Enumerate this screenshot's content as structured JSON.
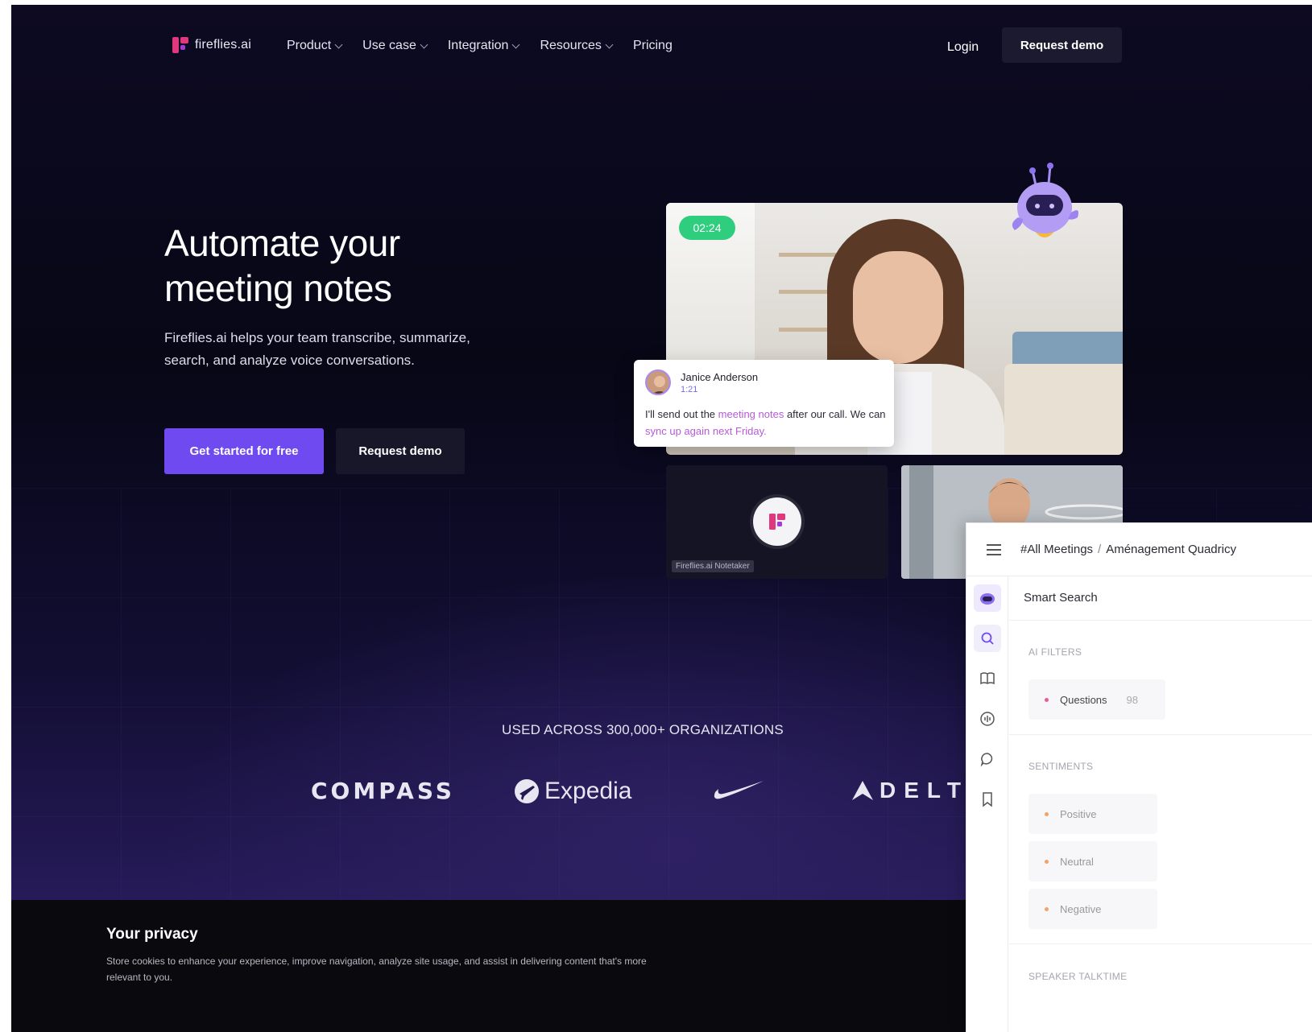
{
  "nav": {
    "logo_text": "fireflies.ai",
    "menu": [
      {
        "label": "Product",
        "dropdown": true
      },
      {
        "label": "Use case",
        "dropdown": true
      },
      {
        "label": "Integration",
        "dropdown": true
      },
      {
        "label": "Resources",
        "dropdown": true
      },
      {
        "label": "Pricing",
        "dropdown": false
      }
    ],
    "login": "Login",
    "request_demo": "Request demo"
  },
  "hero": {
    "title_line1": "Automate your",
    "title_line2": "meeting notes",
    "subtitle": "Fireflies.ai helps your team transcribe, summarize, search, and analyze voice conversations.",
    "cta_primary": "Get started for free",
    "cta_secondary": "Request demo"
  },
  "video": {
    "timer": "02:24",
    "chat": {
      "name": "Janice Anderson",
      "time": "1:21",
      "text_1": "I'll send out the ",
      "highlight_1": "meeting notes",
      "text_2": " after our call. We can ",
      "highlight_2": "sync up again next Friday."
    },
    "notetaker_label": "Fireflies.ai Notetaker"
  },
  "trust": {
    "heading": "USED ACROSS 300,000+ ORGANIZATIONS",
    "brands": [
      "COMPASS",
      "Expedia",
      "Nike",
      "DELTA"
    ]
  },
  "privacy": {
    "title": "Your privacy",
    "text": "Store cookies to enhance your experience, improve navigation, analyze site usage, and assist in delivering content that's more relevant to you."
  },
  "app": {
    "breadcrumb_root": "#All Meetings",
    "breadcrumb_sep": "/",
    "breadcrumb_current": "Aménagement Quadricy",
    "smart_search": "Smart Search",
    "ai_filters_label": "AI FILTERS",
    "questions_label": "Questions",
    "questions_count": "98",
    "sentiments_label": "SENTIMENTS",
    "sentiments": [
      "Positive",
      "Neutral",
      "Negative"
    ],
    "speaker_talktime_label": "SPEAKER TALKTIME"
  },
  "colors": {
    "accent": "#6f4af0",
    "brand_pink": "#e1377d",
    "timer_green": "#2fce7f",
    "highlight": "#b55bd6",
    "positive_dot": "#f0a36a"
  }
}
